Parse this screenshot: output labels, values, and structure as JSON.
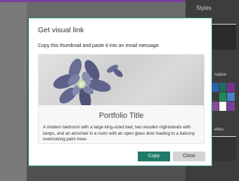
{
  "colors": {
    "accent": "#1f7a67",
    "modal_border": "#1a8a73",
    "top_bar": "#7a3e9d"
  },
  "sidebar": {
    "title": "Styles",
    "section_a_label": "ivation",
    "section_b_label": "ettes",
    "swatches": [
      "#2b5fb0",
      "#1f6b5f",
      "#7a2f8e",
      "#3a3a3a",
      "#1e8a5a",
      "#4a7fc0",
      "#8a4aa0",
      "#ffffff",
      "#7a3e9d"
    ]
  },
  "dialog": {
    "title": "Get visual link",
    "instruction": "Copy this thumbnail and paste it into an email message.",
    "card": {
      "title": "Portfolio Title",
      "description": "A modern bedroom with a large king-sized bed, two wooden nightstands with lamps, and an armchair in a room with an open glass door leading to a balcony overlooking palm trees"
    },
    "copy_label": "Copy",
    "close_label": "Close"
  }
}
